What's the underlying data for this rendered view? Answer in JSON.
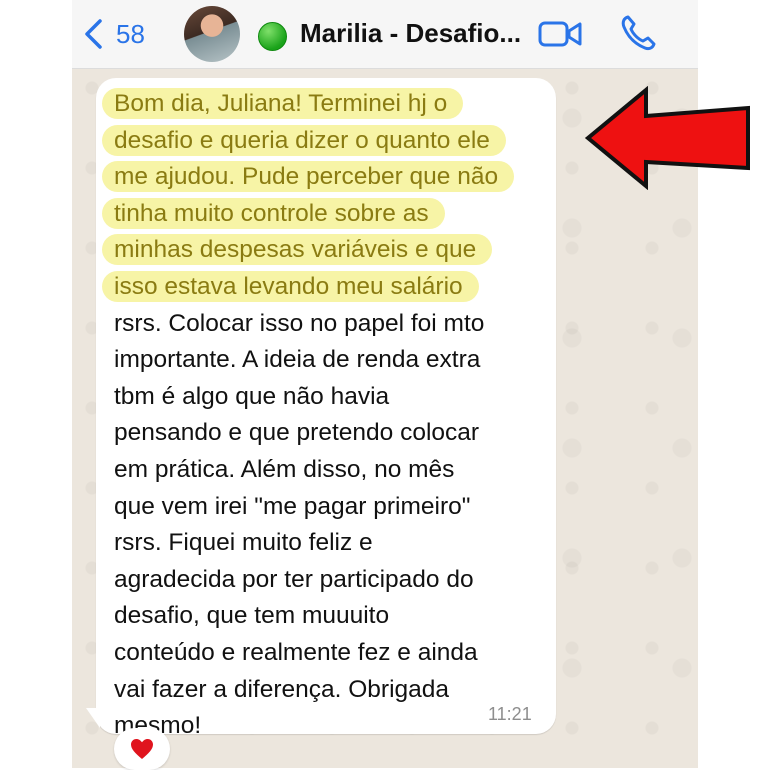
{
  "header": {
    "back_count": "58",
    "contact_name": "Marilia - Desafio..."
  },
  "message": {
    "highlighted_lines": [
      "Bom dia, Juliana! Terminei hj o",
      "desafio e queria dizer o quanto ele",
      "me ajudou. Pude perceber que não",
      "tinha muito controle sobre as",
      "minhas despesas variáveis e que",
      "isso estava levando meu salário"
    ],
    "lines": [
      "rsrs. Colocar isso no papel foi mto",
      "importante. A ideia de renda extra",
      "tbm é algo que não havia",
      "pensando e que pretendo colocar",
      "em prática. Além disso, no mês",
      "que vem irei \"me pagar primeiro\"",
      "rsrs. Fiquei muito feliz e",
      "agradecida por ter participado do",
      "desafio, que tem muuuito",
      "conteúdo e realmente fez e ainda",
      "vai fazer a diferença. Obrigada",
      "mesmo!"
    ],
    "time": "11:21",
    "reaction": "heart"
  },
  "colors": {
    "accent": "#2a74e8",
    "highlight": "#f7f4a6",
    "arrow": "#ee1111",
    "chat_background": "#ece6dd"
  },
  "icons": {
    "back": "chevron-left-icon",
    "status": "green-circle-icon",
    "video": "video-call-icon",
    "phone": "phone-icon",
    "reaction": "heart-icon",
    "annotation": "red-arrow-icon"
  }
}
